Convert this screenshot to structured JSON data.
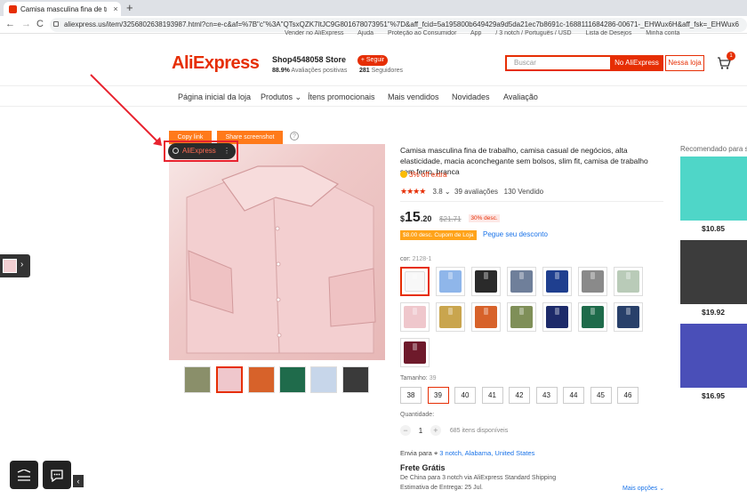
{
  "browser": {
    "tab_title": "Camisa masculina fina de trab",
    "tab_close": "×",
    "new_tab": "+",
    "url": "aliexpress.us/item/3256802638193987.html?cn=e-c&af=%7B\"c\"%3A\"QTsxQZK7ItJC9G801678073951\"%7D&aff_fcid=5a195800b649429a9d5da21ec7b8691c-1688111684286-00671-_EHWux6H&aff_fsk=_EHWux6",
    "back": "←",
    "forward": "→",
    "reload": "C"
  },
  "top_links": [
    "Vender no AliExpress",
    "Ajuda",
    "Proteção ao Consumidor",
    "App",
    "/ 3 notch / Português / USD",
    "Lista de Desejos",
    "Minha conta"
  ],
  "store": {
    "logo": "AliExpress",
    "name": "Shop4548058 Store",
    "positive_pct": "88.9%",
    "positive_label": "Avaliações positivas",
    "follow_label": "+ Seguir",
    "followers_count": "281",
    "followers_label": "Seguidores",
    "search_placeholder": "Buscar",
    "search_ae_label": "No AliExpress",
    "search_store_label": "Nessa loja",
    "cart_count": "1"
  },
  "store_nav": [
    "Página inicial da loja",
    "Produtos",
    "Ítens promocionais",
    "Mais vendidos",
    "Novidades",
    "Avaliação"
  ],
  "gallery": {
    "copy_link": "Copy link",
    "share_screenshot": "Share screenshot",
    "help": "?",
    "ae_pill": "AliExpress",
    "ae_pill_more": "⋮"
  },
  "product": {
    "title": "Camisa masculina fina de trabalho, camisa casual de negócios, alta elasticidade, macia aconchegante sem bolsos, slim fit, camisa de trabalho sem ferro, branca",
    "off_extra": "3% off extra",
    "stars": "★★★★",
    "rating": "3.8",
    "rating_suffix": "⌄",
    "reviews": "39 avaliações",
    "sold": "130 Vendido",
    "price_currency": "$",
    "price_int": "15",
    "price_dec": ".20",
    "price_old": "$21.71",
    "price_discount": "30% desc.",
    "coupon": "$8.00 desc. Cupom de Loja",
    "coupon_link": "Pegue seu desconto",
    "color_label": "cor:",
    "color_value": "2128-1",
    "size_label": "Tamanho:",
    "size_value": "39",
    "sizes": [
      "38",
      "39",
      "40",
      "41",
      "42",
      "43",
      "44",
      "45",
      "46"
    ],
    "qty_label": "Quantidade:",
    "qty_minus": "−",
    "qty_value": "1",
    "qty_plus": "+",
    "qty_available": "685 itens disponíveis",
    "ship_to_label": "Envia para",
    "ship_to": "3 notch, Alabama, United States",
    "shipping_title": "Frete Grátis",
    "shipping_desc": "De China para 3 notch via AliExpress Standard Shipping",
    "shipping_est": "Estimativa de Entrega: 25 Jul.",
    "more_options": "Mais opções ⌄"
  },
  "colors": {
    "accent": "#e62e04",
    "swatches": [
      "#f8f8f8",
      "#8fb6ea",
      "#2a2a2a",
      "#6f7f9a",
      "#1f3f8f",
      "#8a8a8a",
      "#b9cbb8",
      "#efc7cc",
      "#c9a54e",
      "#d7622a",
      "#7f8f58",
      "#1d2b6a",
      "#1f6b4b",
      "#28406a",
      "#6e1a2b"
    ],
    "thumbs": [
      "#8a8f6a",
      "#efc7cc",
      "#d7622a",
      "#1f6b4b",
      "#c7d6ea",
      "#3a3a3a"
    ]
  },
  "recommended": {
    "title": "Recomendado para si",
    "items": [
      {
        "price": "$10.85",
        "color": "#4fd6c8"
      },
      {
        "price": "$19.92",
        "color": "#3c3c3c"
      },
      {
        "price": "$16.95",
        "color": "#4a4fb8"
      }
    ]
  },
  "widgets": {
    "left_arrow": "›",
    "bottom_arrow": "‹"
  }
}
